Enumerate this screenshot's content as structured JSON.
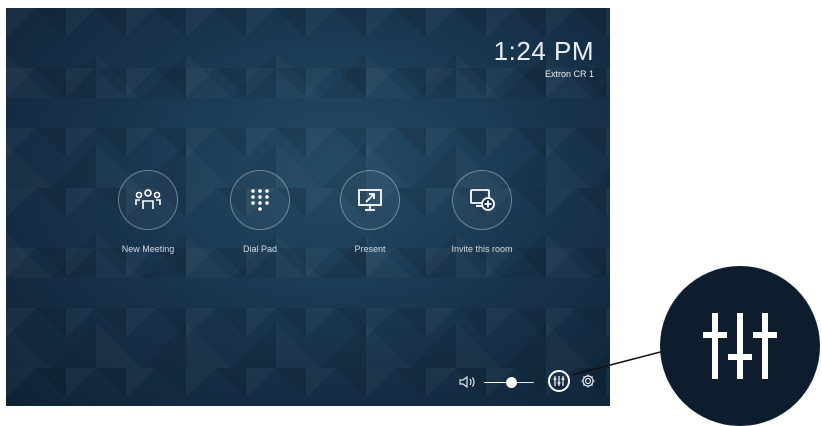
{
  "header": {
    "time": "1:24 PM",
    "room_name": "Extron CR 1"
  },
  "actions": [
    {
      "label": "New Meeting",
      "icon": "people-icon"
    },
    {
      "label": "Dial Pad",
      "icon": "dialpad-icon"
    },
    {
      "label": "Present",
      "icon": "present-icon"
    },
    {
      "label": "Invite this room",
      "icon": "invite-room-icon"
    }
  ],
  "controls": {
    "volume_level": 0.55,
    "icons": [
      "volume-icon",
      "mixer-icon",
      "gear-icon"
    ]
  },
  "colors": {
    "background": "#17324a",
    "text": "#e8eef4",
    "zoom_circle": "#0d1d2d"
  }
}
